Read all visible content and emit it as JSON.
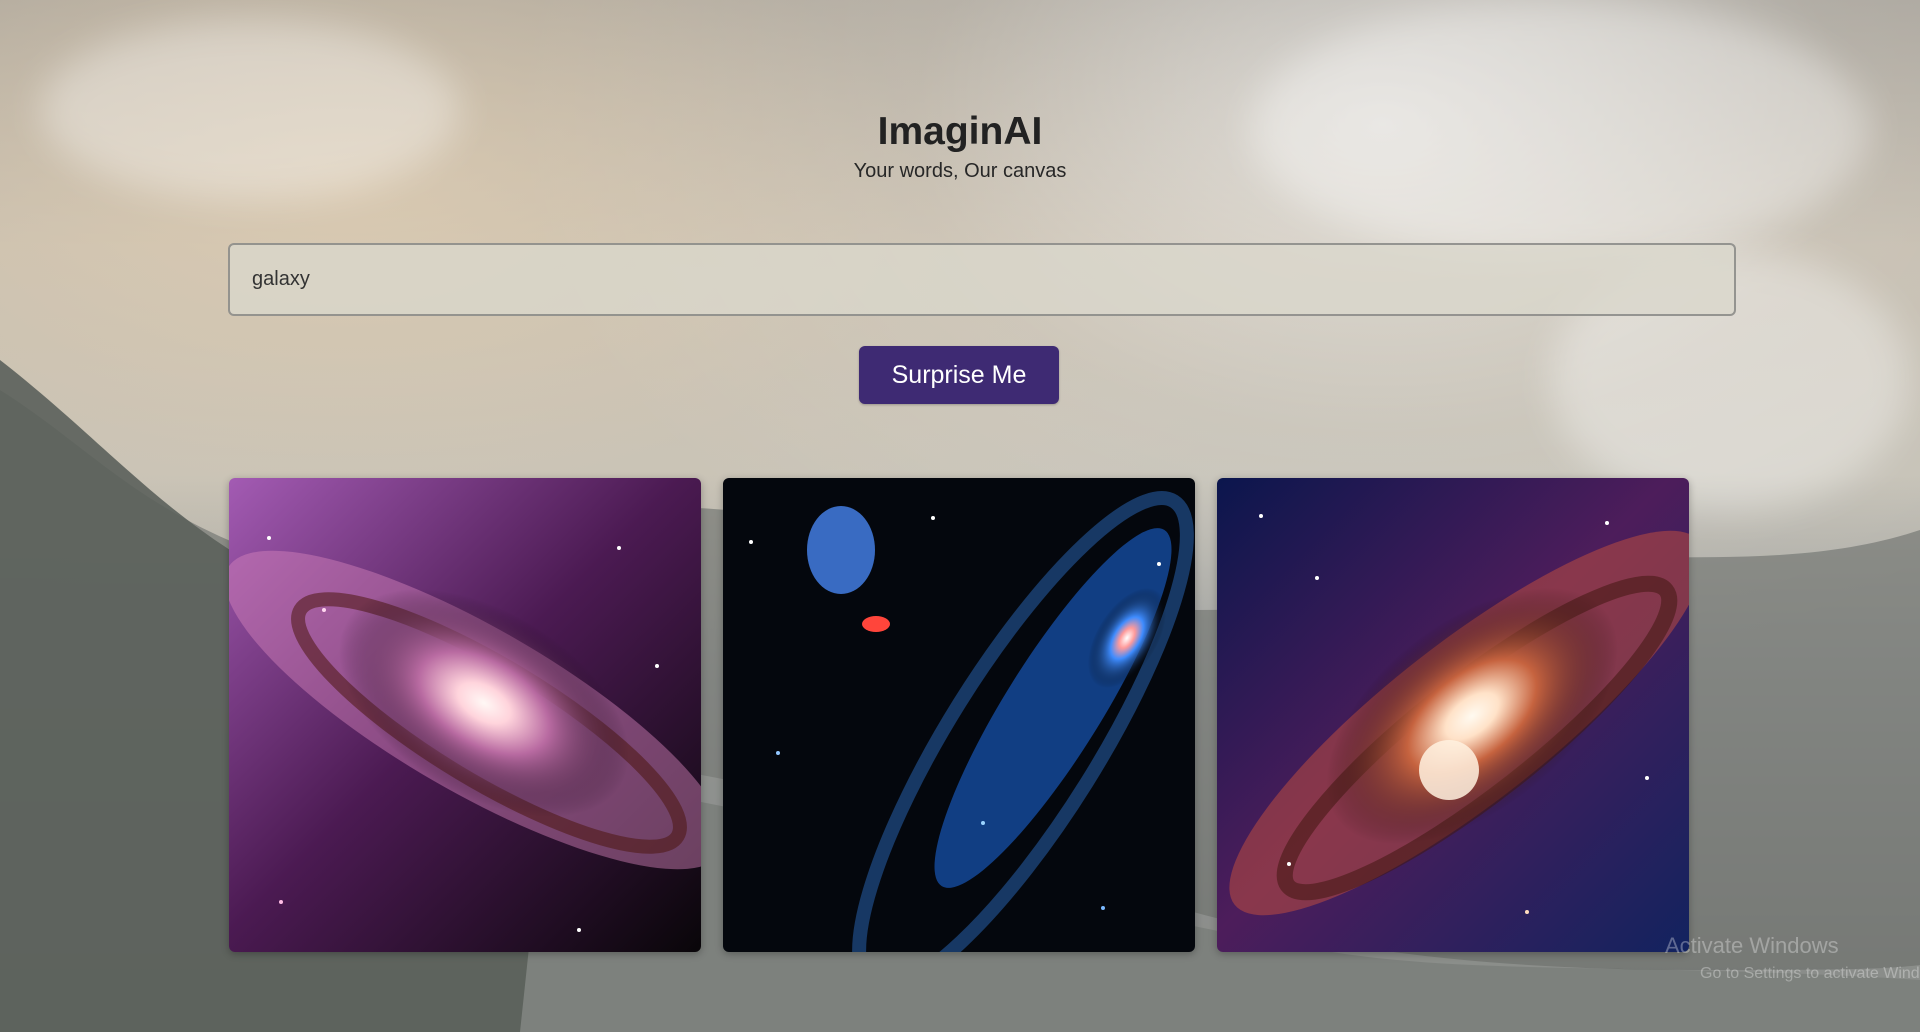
{
  "app": {
    "title": "ImaginAI",
    "subtitle": "Your words, Our canvas"
  },
  "prompt": {
    "value": "galaxy"
  },
  "actions": {
    "surprise_label": "Surprise Me"
  },
  "gallery": {
    "images": [
      {
        "name": "purple galaxy image",
        "theme": "purple spiral galaxy"
      },
      {
        "name": "blue galaxy image",
        "theme": "blue galaxy with star field"
      },
      {
        "name": "orange galaxy image",
        "theme": "orange and blue spiral galaxy"
      }
    ]
  },
  "system": {
    "watermark_line_1": "Activate Windows",
    "watermark_line_2": "Go to Settings to activate Windows."
  },
  "colors": {
    "button_background": "#3e2a73",
    "button_text": "#ffffff",
    "title_text": "#222222",
    "input_background": "#dad7cc"
  }
}
